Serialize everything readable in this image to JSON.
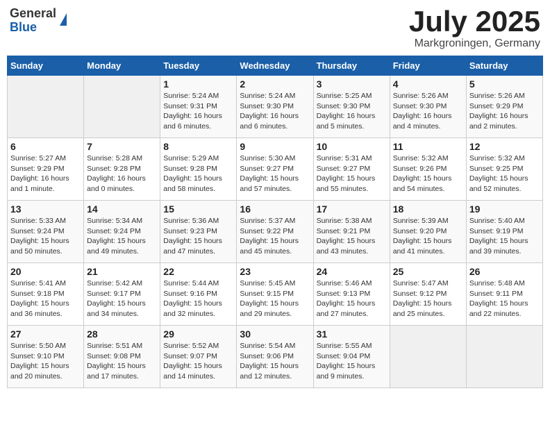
{
  "logo": {
    "line1": "General",
    "line2": "Blue"
  },
  "title": "July 2025",
  "location": "Markgroningen, Germany",
  "weekdays": [
    "Sunday",
    "Monday",
    "Tuesday",
    "Wednesday",
    "Thursday",
    "Friday",
    "Saturday"
  ],
  "weeks": [
    [
      {
        "day": "",
        "info": ""
      },
      {
        "day": "",
        "info": ""
      },
      {
        "day": "1",
        "info": "Sunrise: 5:24 AM\nSunset: 9:31 PM\nDaylight: 16 hours and 6 minutes."
      },
      {
        "day": "2",
        "info": "Sunrise: 5:24 AM\nSunset: 9:30 PM\nDaylight: 16 hours and 6 minutes."
      },
      {
        "day": "3",
        "info": "Sunrise: 5:25 AM\nSunset: 9:30 PM\nDaylight: 16 hours and 5 minutes."
      },
      {
        "day": "4",
        "info": "Sunrise: 5:26 AM\nSunset: 9:30 PM\nDaylight: 16 hours and 4 minutes."
      },
      {
        "day": "5",
        "info": "Sunrise: 5:26 AM\nSunset: 9:29 PM\nDaylight: 16 hours and 2 minutes."
      }
    ],
    [
      {
        "day": "6",
        "info": "Sunrise: 5:27 AM\nSunset: 9:29 PM\nDaylight: 16 hours and 1 minute."
      },
      {
        "day": "7",
        "info": "Sunrise: 5:28 AM\nSunset: 9:28 PM\nDaylight: 16 hours and 0 minutes."
      },
      {
        "day": "8",
        "info": "Sunrise: 5:29 AM\nSunset: 9:28 PM\nDaylight: 15 hours and 58 minutes."
      },
      {
        "day": "9",
        "info": "Sunrise: 5:30 AM\nSunset: 9:27 PM\nDaylight: 15 hours and 57 minutes."
      },
      {
        "day": "10",
        "info": "Sunrise: 5:31 AM\nSunset: 9:27 PM\nDaylight: 15 hours and 55 minutes."
      },
      {
        "day": "11",
        "info": "Sunrise: 5:32 AM\nSunset: 9:26 PM\nDaylight: 15 hours and 54 minutes."
      },
      {
        "day": "12",
        "info": "Sunrise: 5:32 AM\nSunset: 9:25 PM\nDaylight: 15 hours and 52 minutes."
      }
    ],
    [
      {
        "day": "13",
        "info": "Sunrise: 5:33 AM\nSunset: 9:24 PM\nDaylight: 15 hours and 50 minutes."
      },
      {
        "day": "14",
        "info": "Sunrise: 5:34 AM\nSunset: 9:24 PM\nDaylight: 15 hours and 49 minutes."
      },
      {
        "day": "15",
        "info": "Sunrise: 5:36 AM\nSunset: 9:23 PM\nDaylight: 15 hours and 47 minutes."
      },
      {
        "day": "16",
        "info": "Sunrise: 5:37 AM\nSunset: 9:22 PM\nDaylight: 15 hours and 45 minutes."
      },
      {
        "day": "17",
        "info": "Sunrise: 5:38 AM\nSunset: 9:21 PM\nDaylight: 15 hours and 43 minutes."
      },
      {
        "day": "18",
        "info": "Sunrise: 5:39 AM\nSunset: 9:20 PM\nDaylight: 15 hours and 41 minutes."
      },
      {
        "day": "19",
        "info": "Sunrise: 5:40 AM\nSunset: 9:19 PM\nDaylight: 15 hours and 39 minutes."
      }
    ],
    [
      {
        "day": "20",
        "info": "Sunrise: 5:41 AM\nSunset: 9:18 PM\nDaylight: 15 hours and 36 minutes."
      },
      {
        "day": "21",
        "info": "Sunrise: 5:42 AM\nSunset: 9:17 PM\nDaylight: 15 hours and 34 minutes."
      },
      {
        "day": "22",
        "info": "Sunrise: 5:44 AM\nSunset: 9:16 PM\nDaylight: 15 hours and 32 minutes."
      },
      {
        "day": "23",
        "info": "Sunrise: 5:45 AM\nSunset: 9:15 PM\nDaylight: 15 hours and 29 minutes."
      },
      {
        "day": "24",
        "info": "Sunrise: 5:46 AM\nSunset: 9:13 PM\nDaylight: 15 hours and 27 minutes."
      },
      {
        "day": "25",
        "info": "Sunrise: 5:47 AM\nSunset: 9:12 PM\nDaylight: 15 hours and 25 minutes."
      },
      {
        "day": "26",
        "info": "Sunrise: 5:48 AM\nSunset: 9:11 PM\nDaylight: 15 hours and 22 minutes."
      }
    ],
    [
      {
        "day": "27",
        "info": "Sunrise: 5:50 AM\nSunset: 9:10 PM\nDaylight: 15 hours and 20 minutes."
      },
      {
        "day": "28",
        "info": "Sunrise: 5:51 AM\nSunset: 9:08 PM\nDaylight: 15 hours and 17 minutes."
      },
      {
        "day": "29",
        "info": "Sunrise: 5:52 AM\nSunset: 9:07 PM\nDaylight: 15 hours and 14 minutes."
      },
      {
        "day": "30",
        "info": "Sunrise: 5:54 AM\nSunset: 9:06 PM\nDaylight: 15 hours and 12 minutes."
      },
      {
        "day": "31",
        "info": "Sunrise: 5:55 AM\nSunset: 9:04 PM\nDaylight: 15 hours and 9 minutes."
      },
      {
        "day": "",
        "info": ""
      },
      {
        "day": "",
        "info": ""
      }
    ]
  ]
}
